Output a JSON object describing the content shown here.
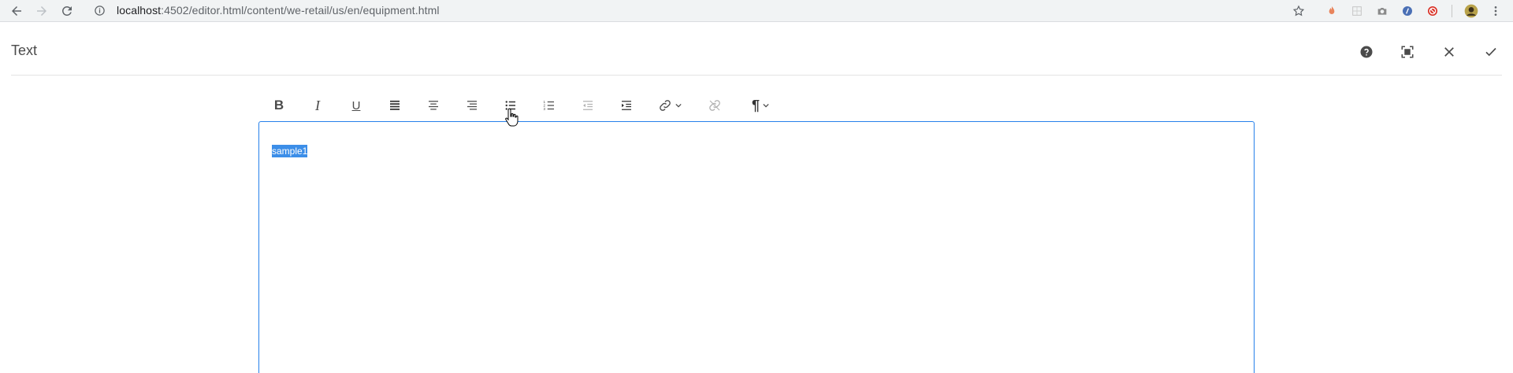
{
  "browser": {
    "url_host": "localhost",
    "url_path": ":4502/editor.html/content/we-retail/us/en/equipment.html",
    "icons": [
      "back-arrow-icon",
      "forward-arrow-icon",
      "reload-icon",
      "info-icon",
      "star-icon",
      "extension-icons",
      "profile-icon",
      "menu-icon"
    ]
  },
  "dialog": {
    "title": "Text",
    "actions": [
      "help-icon",
      "fullscreen-icon",
      "close-icon",
      "done-icon"
    ]
  },
  "toolbar": {
    "tools": [
      {
        "name": "bold",
        "label": "B"
      },
      {
        "name": "italic",
        "label": "I"
      },
      {
        "name": "underline",
        "label": "U"
      },
      {
        "name": "align-left"
      },
      {
        "name": "align-center"
      },
      {
        "name": "align-right"
      },
      {
        "name": "bulleted-list"
      },
      {
        "name": "numbered-list"
      },
      {
        "name": "outdent"
      },
      {
        "name": "indent"
      },
      {
        "name": "link"
      },
      {
        "name": "unlink"
      },
      {
        "name": "paragraph-format",
        "label": "¶"
      }
    ]
  },
  "editor": {
    "content": "sample1"
  },
  "colors": {
    "accent": "#2680eb",
    "selection": "#3c8ee8"
  }
}
